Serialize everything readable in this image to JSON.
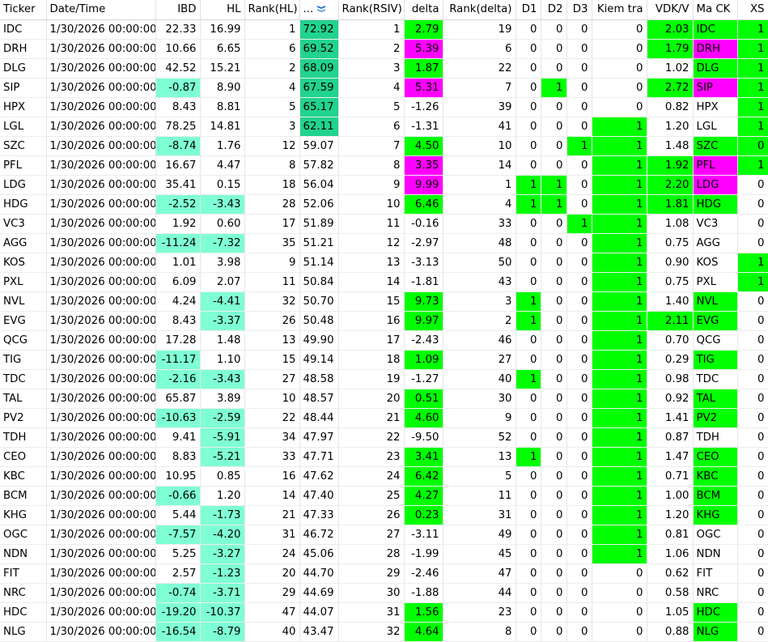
{
  "columns": [
    {
      "key": "ticker",
      "label": "Ticker",
      "align": "lft",
      "w": 57
    },
    {
      "key": "dt",
      "label": "Date/Time",
      "align": "lft",
      "w": 135
    },
    {
      "key": "ibd",
      "label": "IBD",
      "align": "num",
      "w": 55
    },
    {
      "key": "hl",
      "label": "HL",
      "align": "num",
      "w": 55
    },
    {
      "key": "rank_hl",
      "label": "Rank(HL)",
      "align": "num",
      "w": 68
    },
    {
      "key": "rsiv",
      "label": "...",
      "align": "lft",
      "w": 48,
      "sort": true
    },
    {
      "key": "rank_rsiv",
      "label": "Rank(RSIV)",
      "align": "num",
      "w": 81
    },
    {
      "key": "delta",
      "label": "delta",
      "align": "num",
      "w": 48
    },
    {
      "key": "rank_delta",
      "label": "Rank(delta)",
      "align": "num",
      "w": 90
    },
    {
      "key": "d1",
      "label": "D1",
      "align": "num",
      "w": 31
    },
    {
      "key": "d2",
      "label": "D2",
      "align": "num",
      "w": 32
    },
    {
      "key": "d3",
      "label": "D3",
      "align": "num",
      "w": 31
    },
    {
      "key": "kiem",
      "label": "Kiem tra",
      "align": "num",
      "w": 68
    },
    {
      "key": "vdk",
      "label": "VDK/V",
      "align": "num",
      "w": 57
    },
    {
      "key": "mack",
      "label": "Ma CK",
      "align": "lft",
      "w": 55
    },
    {
      "key": "xs",
      "label": "XS",
      "align": "num",
      "w": 38
    }
  ],
  "colors": {
    "aqua": "#7fffd4",
    "green": "#00ff00",
    "magenta": "#ff00ff",
    "teal": "#21d38d"
  },
  "rows": [
    {
      "ticker": "IDC",
      "dt": "1/30/2026 00:00:00",
      "ibd": "22.33",
      "hl": "16.99",
      "rank_hl": "1",
      "rsiv": "72.92",
      "rank_rsiv": "1",
      "delta": "2.79",
      "rank_delta": "19",
      "d1": "0",
      "d2": "0",
      "d3": "0",
      "kiem": "0",
      "vdk": "2.03",
      "mack": "IDC",
      "xs": "1",
      "bg": {
        "rsiv": "teal",
        "delta": "green",
        "vdk": "green",
        "mack": "green",
        "xs": "green"
      }
    },
    {
      "ticker": "DRH",
      "dt": "1/30/2026 00:00:00",
      "ibd": "10.66",
      "hl": "6.65",
      "rank_hl": "6",
      "rsiv": "69.52",
      "rank_rsiv": "2",
      "delta": "5.39",
      "rank_delta": "6",
      "d1": "0",
      "d2": "0",
      "d3": "0",
      "kiem": "0",
      "vdk": "1.79",
      "mack": "DRH",
      "xs": "1",
      "bg": {
        "rsiv": "teal",
        "delta": "magenta",
        "vdk": "green",
        "mack": "magenta",
        "xs": "green"
      }
    },
    {
      "ticker": "DLG",
      "dt": "1/30/2026 00:00:00",
      "ibd": "42.52",
      "hl": "15.21",
      "rank_hl": "2",
      "rsiv": "68.09",
      "rank_rsiv": "3",
      "delta": "1.87",
      "rank_delta": "22",
      "d1": "0",
      "d2": "0",
      "d3": "0",
      "kiem": "0",
      "vdk": "1.02",
      "mack": "DLG",
      "xs": "1",
      "bg": {
        "rsiv": "teal",
        "delta": "green",
        "mack": "green",
        "xs": "green"
      }
    },
    {
      "ticker": "SIP",
      "dt": "1/30/2026 00:00:00",
      "ibd": "-0.87",
      "hl": "8.90",
      "rank_hl": "4",
      "rsiv": "67.59",
      "rank_rsiv": "4",
      "delta": "5.31",
      "rank_delta": "7",
      "d1": "0",
      "d2": "1",
      "d3": "0",
      "kiem": "0",
      "vdk": "2.72",
      "mack": "SIP",
      "xs": "1",
      "bg": {
        "ibd": "aqua",
        "rsiv": "teal",
        "delta": "magenta",
        "d2": "green",
        "vdk": "green",
        "mack": "magenta",
        "xs": "green"
      }
    },
    {
      "ticker": "HPX",
      "dt": "1/30/2026 00:00:00",
      "ibd": "8.43",
      "hl": "8.81",
      "rank_hl": "5",
      "rsiv": "65.17",
      "rank_rsiv": "5",
      "delta": "-1.26",
      "rank_delta": "39",
      "d1": "0",
      "d2": "0",
      "d3": "0",
      "kiem": "0",
      "vdk": "0.82",
      "mack": "HPX",
      "xs": "1",
      "bg": {
        "rsiv": "teal",
        "xs": "green"
      }
    },
    {
      "ticker": "LGL",
      "dt": "1/30/2026 00:00:00",
      "ibd": "78.25",
      "hl": "14.81",
      "rank_hl": "3",
      "rsiv": "62.11",
      "rank_rsiv": "6",
      "delta": "-1.31",
      "rank_delta": "41",
      "d1": "0",
      "d2": "0",
      "d3": "0",
      "kiem": "1",
      "vdk": "1.20",
      "mack": "LGL",
      "xs": "1",
      "bg": {
        "rsiv": "teal",
        "kiem": "green",
        "xs": "green"
      }
    },
    {
      "ticker": "SZC",
      "dt": "1/30/2026 00:00:00",
      "ibd": "-8.74",
      "hl": "1.76",
      "rank_hl": "12",
      "rsiv": "59.07",
      "rank_rsiv": "7",
      "delta": "4.50",
      "rank_delta": "10",
      "d1": "0",
      "d2": "0",
      "d3": "1",
      "kiem": "1",
      "vdk": "1.48",
      "mack": "SZC",
      "xs": "0",
      "bg": {
        "ibd": "aqua",
        "delta": "green",
        "d3": "green",
        "kiem": "green",
        "mack": "green",
        "xs": "green"
      }
    },
    {
      "ticker": "PFL",
      "dt": "1/30/2026 00:00:00",
      "ibd": "16.67",
      "hl": "4.47",
      "rank_hl": "8",
      "rsiv": "57.82",
      "rank_rsiv": "8",
      "delta": "3.35",
      "rank_delta": "14",
      "d1": "0",
      "d2": "0",
      "d3": "0",
      "kiem": "1",
      "vdk": "1.92",
      "mack": "PFL",
      "xs": "1",
      "bg": {
        "delta": "magenta",
        "kiem": "green",
        "vdk": "green",
        "mack": "magenta",
        "xs": "green"
      }
    },
    {
      "ticker": "LDG",
      "dt": "1/30/2026 00:00:00",
      "ibd": "35.41",
      "hl": "0.15",
      "rank_hl": "18",
      "rsiv": "56.04",
      "rank_rsiv": "9",
      "delta": "9.99",
      "rank_delta": "1",
      "d1": "1",
      "d2": "1",
      "d3": "0",
      "kiem": "1",
      "vdk": "2.20",
      "mack": "LDG",
      "xs": "0",
      "bg": {
        "delta": "magenta",
        "d1": "green",
        "d2": "green",
        "kiem": "green",
        "vdk": "green",
        "mack": "magenta"
      }
    },
    {
      "ticker": "HDG",
      "dt": "1/30/2026 00:00:00",
      "ibd": "-2.52",
      "hl": "-3.43",
      "rank_hl": "28",
      "rsiv": "52.06",
      "rank_rsiv": "10",
      "delta": "6.46",
      "rank_delta": "4",
      "d1": "1",
      "d2": "1",
      "d3": "0",
      "kiem": "1",
      "vdk": "1.81",
      "mack": "HDG",
      "xs": "0",
      "bg": {
        "ibd": "aqua",
        "hl": "aqua",
        "delta": "green",
        "d1": "green",
        "d2": "green",
        "kiem": "green",
        "vdk": "green",
        "mack": "green"
      }
    },
    {
      "ticker": "VC3",
      "dt": "1/30/2026 00:00:00",
      "ibd": "1.92",
      "hl": "0.60",
      "rank_hl": "17",
      "rsiv": "51.89",
      "rank_rsiv": "11",
      "delta": "-0.16",
      "rank_delta": "33",
      "d1": "0",
      "d2": "0",
      "d3": "1",
      "kiem": "1",
      "vdk": "1.08",
      "mack": "VC3",
      "xs": "0",
      "bg": {
        "d3": "green",
        "kiem": "green"
      }
    },
    {
      "ticker": "AGG",
      "dt": "1/30/2026 00:00:00",
      "ibd": "-11.24",
      "hl": "-7.32",
      "rank_hl": "35",
      "rsiv": "51.21",
      "rank_rsiv": "12",
      "delta": "-2.97",
      "rank_delta": "48",
      "d1": "0",
      "d2": "0",
      "d3": "0",
      "kiem": "1",
      "vdk": "0.75",
      "mack": "AGG",
      "xs": "0",
      "bg": {
        "ibd": "aqua",
        "hl": "aqua",
        "kiem": "green"
      }
    },
    {
      "ticker": "KOS",
      "dt": "1/30/2026 00:00:00",
      "ibd": "1.01",
      "hl": "3.98",
      "rank_hl": "9",
      "rsiv": "51.14",
      "rank_rsiv": "13",
      "delta": "-3.13",
      "rank_delta": "50",
      "d1": "0",
      "d2": "0",
      "d3": "0",
      "kiem": "1",
      "vdk": "0.90",
      "mack": "KOS",
      "xs": "1",
      "bg": {
        "kiem": "green",
        "xs": "green"
      }
    },
    {
      "ticker": "PXL",
      "dt": "1/30/2026 00:00:00",
      "ibd": "6.09",
      "hl": "2.07",
      "rank_hl": "11",
      "rsiv": "50.84",
      "rank_rsiv": "14",
      "delta": "-1.81",
      "rank_delta": "43",
      "d1": "0",
      "d2": "0",
      "d3": "0",
      "kiem": "1",
      "vdk": "0.75",
      "mack": "PXL",
      "xs": "1",
      "bg": {
        "kiem": "green",
        "xs": "green"
      }
    },
    {
      "ticker": "NVL",
      "dt": "1/30/2026 00:00:00",
      "ibd": "4.24",
      "hl": "-4.41",
      "rank_hl": "32",
      "rsiv": "50.70",
      "rank_rsiv": "15",
      "delta": "9.73",
      "rank_delta": "3",
      "d1": "1",
      "d2": "0",
      "d3": "0",
      "kiem": "1",
      "vdk": "1.40",
      "mack": "NVL",
      "xs": "0",
      "bg": {
        "hl": "aqua",
        "delta": "green",
        "d1": "green",
        "kiem": "green",
        "mack": "green"
      }
    },
    {
      "ticker": "EVG",
      "dt": "1/30/2026 00:00:00",
      "ibd": "8.43",
      "hl": "-3.37",
      "rank_hl": "26",
      "rsiv": "50.48",
      "rank_rsiv": "16",
      "delta": "9.97",
      "rank_delta": "2",
      "d1": "1",
      "d2": "0",
      "d3": "0",
      "kiem": "1",
      "vdk": "2.11",
      "mack": "EVG",
      "xs": "0",
      "bg": {
        "hl": "aqua",
        "delta": "green",
        "d1": "green",
        "kiem": "green",
        "vdk": "green",
        "mack": "green"
      }
    },
    {
      "ticker": "QCG",
      "dt": "1/30/2026 00:00:00",
      "ibd": "17.28",
      "hl": "1.48",
      "rank_hl": "13",
      "rsiv": "49.90",
      "rank_rsiv": "17",
      "delta": "-2.43",
      "rank_delta": "46",
      "d1": "0",
      "d2": "0",
      "d3": "0",
      "kiem": "1",
      "vdk": "0.70",
      "mack": "QCG",
      "xs": "0",
      "bg": {
        "kiem": "green"
      }
    },
    {
      "ticker": "TIG",
      "dt": "1/30/2026 00:00:00",
      "ibd": "-11.17",
      "hl": "1.10",
      "rank_hl": "15",
      "rsiv": "49.14",
      "rank_rsiv": "18",
      "delta": "1.09",
      "rank_delta": "27",
      "d1": "0",
      "d2": "0",
      "d3": "0",
      "kiem": "1",
      "vdk": "0.29",
      "mack": "TIG",
      "xs": "0",
      "bg": {
        "ibd": "aqua",
        "delta": "green",
        "kiem": "green",
        "mack": "green"
      }
    },
    {
      "ticker": "TDC",
      "dt": "1/30/2026 00:00:00",
      "ibd": "-2.16",
      "hl": "-3.43",
      "rank_hl": "27",
      "rsiv": "48.58",
      "rank_rsiv": "19",
      "delta": "-1.27",
      "rank_delta": "40",
      "d1": "1",
      "d2": "0",
      "d3": "0",
      "kiem": "1",
      "vdk": "0.98",
      "mack": "TDC",
      "xs": "0",
      "bg": {
        "ibd": "aqua",
        "hl": "aqua",
        "d1": "green",
        "kiem": "green"
      }
    },
    {
      "ticker": "TAL",
      "dt": "1/30/2026 00:00:00",
      "ibd": "65.87",
      "hl": "3.89",
      "rank_hl": "10",
      "rsiv": "48.57",
      "rank_rsiv": "20",
      "delta": "0.51",
      "rank_delta": "30",
      "d1": "0",
      "d2": "0",
      "d3": "0",
      "kiem": "1",
      "vdk": "0.92",
      "mack": "TAL",
      "xs": "0",
      "bg": {
        "delta": "green",
        "kiem": "green",
        "mack": "green"
      }
    },
    {
      "ticker": "PV2",
      "dt": "1/30/2026 00:00:00",
      "ibd": "-10.63",
      "hl": "-2.59",
      "rank_hl": "22",
      "rsiv": "48.44",
      "rank_rsiv": "21",
      "delta": "4.60",
      "rank_delta": "9",
      "d1": "0",
      "d2": "0",
      "d3": "0",
      "kiem": "1",
      "vdk": "1.41",
      "mack": "PV2",
      "xs": "0",
      "bg": {
        "ibd": "aqua",
        "hl": "aqua",
        "delta": "green",
        "kiem": "green",
        "mack": "green"
      }
    },
    {
      "ticker": "TDH",
      "dt": "1/30/2026 00:00:00",
      "ibd": "9.41",
      "hl": "-5.91",
      "rank_hl": "34",
      "rsiv": "47.97",
      "rank_rsiv": "22",
      "delta": "-9.50",
      "rank_delta": "52",
      "d1": "0",
      "d2": "0",
      "d3": "0",
      "kiem": "1",
      "vdk": "0.87",
      "mack": "TDH",
      "xs": "0",
      "bg": {
        "hl": "aqua",
        "kiem": "green"
      }
    },
    {
      "ticker": "CEO",
      "dt": "1/30/2026 00:00:00",
      "ibd": "8.83",
      "hl": "-5.21",
      "rank_hl": "33",
      "rsiv": "47.71",
      "rank_rsiv": "23",
      "delta": "3.41",
      "rank_delta": "13",
      "d1": "1",
      "d2": "0",
      "d3": "0",
      "kiem": "1",
      "vdk": "1.47",
      "mack": "CEO",
      "xs": "0",
      "bg": {
        "hl": "aqua",
        "delta": "green",
        "d1": "green",
        "kiem": "green",
        "mack": "green"
      }
    },
    {
      "ticker": "KBC",
      "dt": "1/30/2026 00:00:00",
      "ibd": "10.95",
      "hl": "0.85",
      "rank_hl": "16",
      "rsiv": "47.62",
      "rank_rsiv": "24",
      "delta": "6.42",
      "rank_delta": "5",
      "d1": "0",
      "d2": "0",
      "d3": "0",
      "kiem": "1",
      "vdk": "0.71",
      "mack": "KBC",
      "xs": "0",
      "bg": {
        "delta": "green",
        "kiem": "green",
        "mack": "green"
      }
    },
    {
      "ticker": "BCM",
      "dt": "1/30/2026 00:00:00",
      "ibd": "-0.66",
      "hl": "1.20",
      "rank_hl": "14",
      "rsiv": "47.40",
      "rank_rsiv": "25",
      "delta": "4.27",
      "rank_delta": "11",
      "d1": "0",
      "d2": "0",
      "d3": "0",
      "kiem": "1",
      "vdk": "1.00",
      "mack": "BCM",
      "xs": "0",
      "bg": {
        "ibd": "aqua",
        "delta": "green",
        "kiem": "green",
        "mack": "green"
      }
    },
    {
      "ticker": "KHG",
      "dt": "1/30/2026 00:00:00",
      "ibd": "5.44",
      "hl": "-1.73",
      "rank_hl": "21",
      "rsiv": "47.33",
      "rank_rsiv": "26",
      "delta": "0.23",
      "rank_delta": "31",
      "d1": "0",
      "d2": "0",
      "d3": "0",
      "kiem": "1",
      "vdk": "1.20",
      "mack": "KHG",
      "xs": "0",
      "bg": {
        "hl": "aqua",
        "delta": "green",
        "kiem": "green",
        "mack": "green"
      }
    },
    {
      "ticker": "OGC",
      "dt": "1/30/2026 00:00:00",
      "ibd": "-7.57",
      "hl": "-4.20",
      "rank_hl": "31",
      "rsiv": "46.72",
      "rank_rsiv": "27",
      "delta": "-3.11",
      "rank_delta": "49",
      "d1": "0",
      "d2": "0",
      "d3": "0",
      "kiem": "1",
      "vdk": "0.81",
      "mack": "OGC",
      "xs": "0",
      "bg": {
        "ibd": "aqua",
        "hl": "aqua",
        "kiem": "green"
      }
    },
    {
      "ticker": "NDN",
      "dt": "1/30/2026 00:00:00",
      "ibd": "5.25",
      "hl": "-3.27",
      "rank_hl": "24",
      "rsiv": "45.06",
      "rank_rsiv": "28",
      "delta": "-1.99",
      "rank_delta": "45",
      "d1": "0",
      "d2": "0",
      "d3": "0",
      "kiem": "1",
      "vdk": "1.06",
      "mack": "NDN",
      "xs": "0",
      "bg": {
        "hl": "aqua",
        "kiem": "green"
      }
    },
    {
      "ticker": "FIT",
      "dt": "1/30/2026 00:00:00",
      "ibd": "2.57",
      "hl": "-1.23",
      "rank_hl": "20",
      "rsiv": "44.70",
      "rank_rsiv": "29",
      "delta": "-2.46",
      "rank_delta": "47",
      "d1": "0",
      "d2": "0",
      "d3": "0",
      "kiem": "0",
      "vdk": "0.62",
      "mack": "FIT",
      "xs": "0",
      "bg": {
        "hl": "aqua"
      }
    },
    {
      "ticker": "NRC",
      "dt": "1/30/2026 00:00:00",
      "ibd": "-0.74",
      "hl": "-3.71",
      "rank_hl": "29",
      "rsiv": "44.69",
      "rank_rsiv": "30",
      "delta": "-1.88",
      "rank_delta": "44",
      "d1": "0",
      "d2": "0",
      "d3": "0",
      "kiem": "0",
      "vdk": "0.58",
      "mack": "NRC",
      "xs": "0",
      "bg": {
        "ibd": "aqua",
        "hl": "aqua"
      }
    },
    {
      "ticker": "HDC",
      "dt": "1/30/2026 00:00:00",
      "ibd": "-19.20",
      "hl": "-10.37",
      "rank_hl": "47",
      "rsiv": "44.07",
      "rank_rsiv": "31",
      "delta": "1.56",
      "rank_delta": "23",
      "d1": "0",
      "d2": "0",
      "d3": "0",
      "kiem": "0",
      "vdk": "1.05",
      "mack": "HDC",
      "xs": "0",
      "bg": {
        "ibd": "aqua",
        "hl": "aqua",
        "delta": "green",
        "mack": "green"
      }
    },
    {
      "ticker": "NLG",
      "dt": "1/30/2026 00:00:00",
      "ibd": "-16.54",
      "hl": "-8.79",
      "rank_hl": "40",
      "rsiv": "43.47",
      "rank_rsiv": "32",
      "delta": "4.64",
      "rank_delta": "8",
      "d1": "0",
      "d2": "0",
      "d3": "0",
      "kiem": "0",
      "vdk": "0.88",
      "mack": "NLG",
      "xs": "0",
      "bg": {
        "ibd": "aqua",
        "hl": "aqua",
        "delta": "green",
        "mack": "green"
      }
    }
  ]
}
